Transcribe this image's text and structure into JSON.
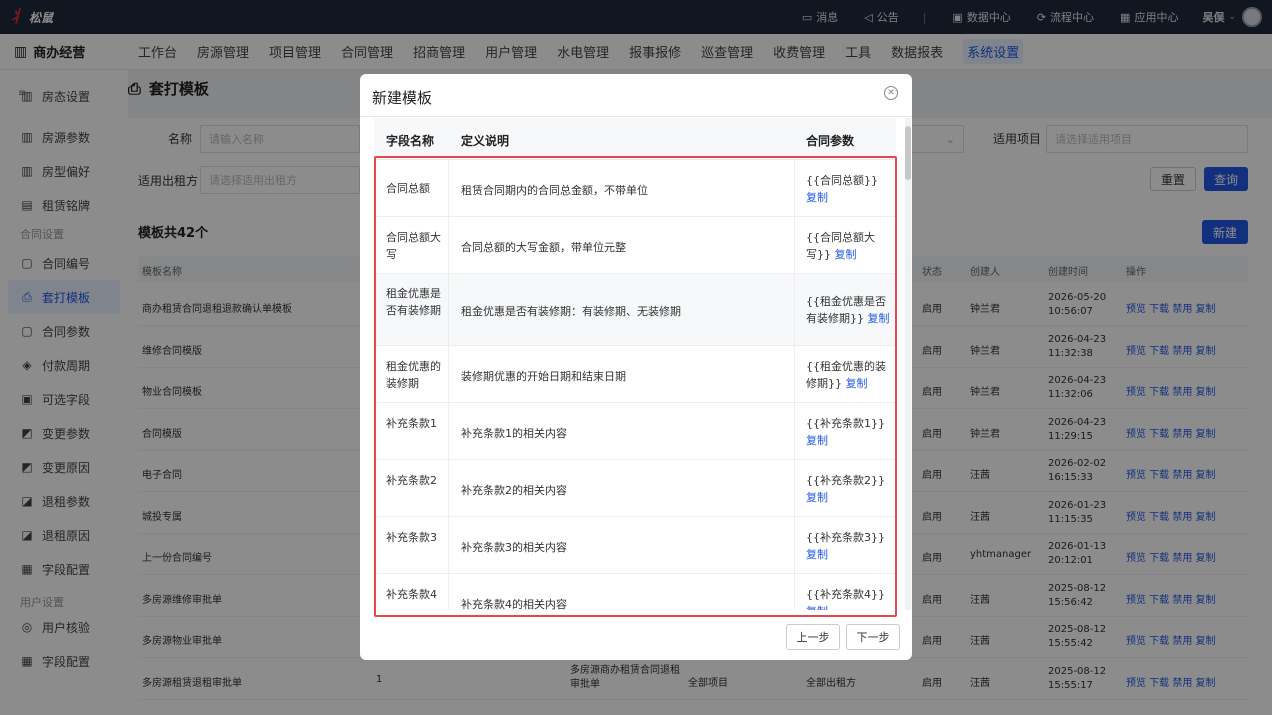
{
  "app": {
    "name": "松鼠"
  },
  "top_nav": {
    "messages": "消息",
    "notice": "公告",
    "data_center": "数据中心",
    "flow_center": "流程中心",
    "app_center": "应用中心",
    "user": "吴俣"
  },
  "navbar": {
    "brand": "商办经营",
    "menu": [
      "工作台",
      "房源管理",
      "项目管理",
      "合同管理",
      "招商管理",
      "用户管理",
      "水电管理",
      "报事报修",
      "巡查管理",
      "收费管理",
      "工具",
      "数据报表",
      "系统设置"
    ],
    "active_index": 12
  },
  "sidebar": {
    "items": [
      {
        "label": "房态设置",
        "icon": "building-icon"
      },
      {
        "label": "房源参数",
        "icon": "building-icon"
      },
      {
        "label": "房型偏好",
        "icon": "building-icon"
      },
      {
        "label": "租赁铭牌",
        "icon": "nameplate-icon"
      },
      {
        "label": "合同编号",
        "icon": "doc-icon"
      },
      {
        "label": "套打模板",
        "icon": "printer-icon"
      },
      {
        "label": "合同参数",
        "icon": "doc-icon"
      },
      {
        "label": "付款周期",
        "icon": "cycle-icon"
      },
      {
        "label": "可选字段",
        "icon": "field-icon"
      },
      {
        "label": "变更参数",
        "icon": "change-icon"
      },
      {
        "label": "变更原因",
        "icon": "change-icon"
      },
      {
        "label": "退租参数",
        "icon": "exit-icon"
      },
      {
        "label": "退租原因",
        "icon": "exit-icon"
      },
      {
        "label": "字段配置",
        "icon": "config-icon"
      },
      {
        "label": "用户核验",
        "icon": "user-check-icon"
      },
      {
        "label": "字段配置",
        "icon": "config-icon"
      }
    ],
    "groups": [
      "合同设置",
      "用户设置"
    ]
  },
  "page": {
    "title": "套打模板",
    "filter": {
      "name_label": "名称",
      "name_placeholder": "请输入名称",
      "tenant_label": "适用出租方",
      "tenant_placeholder": "请选择适用出租方",
      "project_label": "适用项目",
      "project_placeholder": "请选择适用项目",
      "reset": "重置",
      "query": "查询"
    },
    "list": {
      "title": "模板共42个",
      "new_btn": "新建",
      "headers": [
        "模板名称",
        "状态",
        "创建人",
        "创建时间",
        "操作"
      ],
      "ops": "预览 下载 禁用 复制",
      "rows": [
        {
          "name": "商办租赁合同退租退款确认单模板",
          "status": "启用",
          "creator": "钟兰君",
          "date": "2026-05-20",
          "time": "10:56:07"
        },
        {
          "name": "维修合同模版",
          "status": "启用",
          "creator": "钟兰君",
          "date": "2026-04-23",
          "time": "11:32:38"
        },
        {
          "name": "物业合同模板",
          "status": "启用",
          "creator": "钟兰君",
          "date": "2026-04-23",
          "time": "11:32:06"
        },
        {
          "name": "合同模版",
          "status": "启用",
          "creator": "钟兰君",
          "date": "2026-04-23",
          "time": "11:29:15"
        },
        {
          "name": "电子合同",
          "status": "启用",
          "creator": "汪茜",
          "date": "2026-02-02",
          "time": "16:15:33"
        },
        {
          "name": "城投专属",
          "status": "启用",
          "creator": "汪茜",
          "date": "2026-01-23",
          "time": "11:15:35"
        },
        {
          "name": "上一份合同编号",
          "status": "启用",
          "creator": "yhtmanager",
          "date": "2026-01-13",
          "time": "20:12:01"
        },
        {
          "name": "多房源维修审批单",
          "status": "启用",
          "creator": "汪茜",
          "date": "2025-08-12",
          "time": "15:56:42"
        },
        {
          "name": "多房源物业审批单",
          "status": "启用",
          "creator": "汪茜",
          "date": "2025-08-12",
          "time": "15:55:42"
        },
        {
          "name": "多房源租赁退租审批单",
          "status": "启用",
          "creator": "汪茜",
          "date": "2025-08-12",
          "time": "15:55:17",
          "extra1": "1",
          "extra2": "多房源商办租赁合同退租审批单",
          "extra3": "全部项目",
          "extra4": "全部出租方"
        }
      ]
    }
  },
  "dialog": {
    "title": "新建模板",
    "headers": [
      "字段名称",
      "定义说明",
      "合同参数"
    ],
    "copy_label": "复制",
    "rows": [
      {
        "name": "合同总额",
        "desc": "租赁合同期内的合同总金额，不带单位",
        "param": "{{合同总额}}"
      },
      {
        "name": "合同总额大写",
        "desc": "合同总额的大写金额，带单位元整",
        "param": "{{合同总额大写}}"
      },
      {
        "name": "租金优惠是否有装修期",
        "desc": "租金优惠是否有装修期：有装修期、无装修期",
        "param": "{{租金优惠是否有装修期}}"
      },
      {
        "name": "租金优惠的装修期",
        "desc": "装修期优惠的开始日期和结束日期",
        "param": "{{租金优惠的装修期}}"
      },
      {
        "name": "补充条款1",
        "desc": "补充条款1的相关内容",
        "param": "{{补充条款1}}"
      },
      {
        "name": "补充条款2",
        "desc": "补充条款2的相关内容",
        "param": "{{补充条款2}}"
      },
      {
        "name": "补充条款3",
        "desc": "补充条款3的相关内容",
        "param": "{{补充条款3}}"
      },
      {
        "name": "补充条款4",
        "desc": "补充条款4的相关内容",
        "param": "{{补充条款4}}"
      }
    ],
    "prev": "上一步",
    "next": "下一步"
  },
  "colors": {
    "primary": "#2458e6",
    "topbar": "#1f2a3c",
    "highlight": "#e5484d"
  }
}
